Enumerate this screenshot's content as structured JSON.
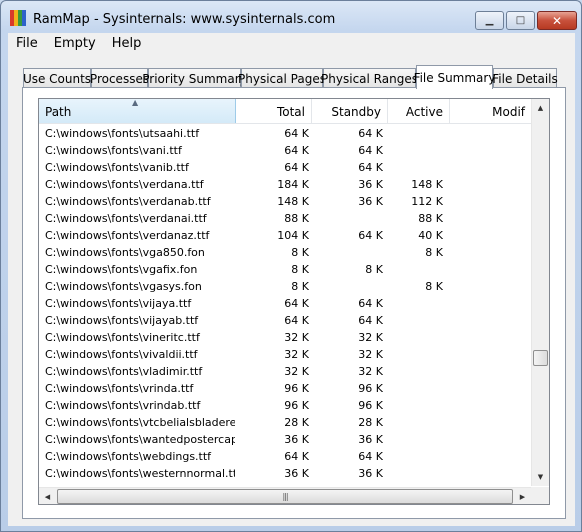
{
  "window": {
    "title": "RamMap - Sysinternals: www.sysinternals.com",
    "icon_colors": [
      "#d93a2b",
      "#f2b21c",
      "#3a9a3a",
      "#2e62c9"
    ],
    "minimize_icon": "minimize-icon",
    "maximize_icon": "maximize-icon",
    "close_icon": "close-icon"
  },
  "menu": [
    "File",
    "Empty",
    "Help"
  ],
  "tabs": [
    {
      "label": "Use Counts"
    },
    {
      "label": "Processes"
    },
    {
      "label": "Priority Summary"
    },
    {
      "label": "Physical Pages"
    },
    {
      "label": "Physical Ranges"
    },
    {
      "label": "File Summary",
      "active": true
    },
    {
      "label": "File Details"
    }
  ],
  "columns": {
    "path": "Path",
    "total": "Total",
    "standby": "Standby",
    "active": "Active",
    "modified": "Modif"
  },
  "rows": [
    {
      "path": "C:\\windows\\fonts\\utsaahi.ttf",
      "total": "64 K",
      "standby": "64 K",
      "active": ""
    },
    {
      "path": "C:\\windows\\fonts\\vani.ttf",
      "total": "64 K",
      "standby": "64 K",
      "active": ""
    },
    {
      "path": "C:\\windows\\fonts\\vanib.ttf",
      "total": "64 K",
      "standby": "64 K",
      "active": ""
    },
    {
      "path": "C:\\windows\\fonts\\verdana.ttf",
      "total": "184 K",
      "standby": "36 K",
      "active": "148 K"
    },
    {
      "path": "C:\\windows\\fonts\\verdanab.ttf",
      "total": "148 K",
      "standby": "36 K",
      "active": "112 K"
    },
    {
      "path": "C:\\windows\\fonts\\verdanai.ttf",
      "total": "88 K",
      "standby": "",
      "active": "88 K"
    },
    {
      "path": "C:\\windows\\fonts\\verdanaz.ttf",
      "total": "104 K",
      "standby": "64 K",
      "active": "40 K"
    },
    {
      "path": "C:\\windows\\fonts\\vga850.fon",
      "total": "8 K",
      "standby": "",
      "active": "8 K"
    },
    {
      "path": "C:\\windows\\fonts\\vgafix.fon",
      "total": "8 K",
      "standby": "8 K",
      "active": ""
    },
    {
      "path": "C:\\windows\\fonts\\vgasys.fon",
      "total": "8 K",
      "standby": "",
      "active": "8 K"
    },
    {
      "path": "C:\\windows\\fonts\\vijaya.ttf",
      "total": "64 K",
      "standby": "64 K",
      "active": ""
    },
    {
      "path": "C:\\windows\\fonts\\vijayab.ttf",
      "total": "64 K",
      "standby": "64 K",
      "active": ""
    },
    {
      "path": "C:\\windows\\fonts\\vineritc.ttf",
      "total": "32 K",
      "standby": "32 K",
      "active": ""
    },
    {
      "path": "C:\\windows\\fonts\\vivaldii.ttf",
      "total": "32 K",
      "standby": "32 K",
      "active": ""
    },
    {
      "path": "C:\\windows\\fonts\\vladimir.ttf",
      "total": "32 K",
      "standby": "32 K",
      "active": ""
    },
    {
      "path": "C:\\windows\\fonts\\vrinda.ttf",
      "total": "96 K",
      "standby": "96 K",
      "active": ""
    },
    {
      "path": "C:\\windows\\fonts\\vrindab.ttf",
      "total": "96 K",
      "standby": "96 K",
      "active": ""
    },
    {
      "path": "C:\\windows\\fonts\\vtcbelialsbladereg...",
      "total": "28 K",
      "standby": "28 K",
      "active": ""
    },
    {
      "path": "C:\\windows\\fonts\\wantedpostercap...",
      "total": "36 K",
      "standby": "36 K",
      "active": ""
    },
    {
      "path": "C:\\windows\\fonts\\webdings.ttf",
      "total": "64 K",
      "standby": "64 K",
      "active": ""
    },
    {
      "path": "C:\\windows\\fonts\\westernnormal.ttf",
      "total": "36 K",
      "standby": "36 K",
      "active": ""
    }
  ],
  "scrollbars": {
    "up_icon": "scroll-up-arrow-icon",
    "down_icon": "scroll-down-arrow-icon",
    "left_icon": "scroll-left-arrow-icon",
    "right_icon": "scroll-right-arrow-icon",
    "grip_icon": "grip-icon"
  }
}
